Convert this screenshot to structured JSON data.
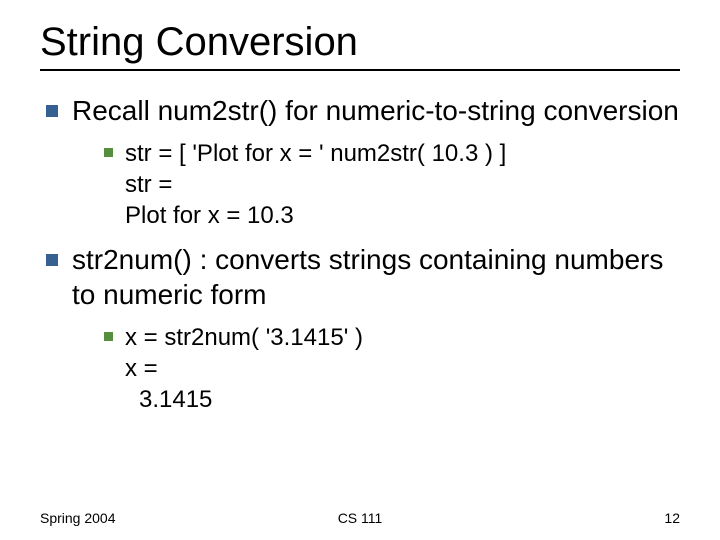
{
  "title": "String Conversion",
  "bullets": [
    {
      "text": "Recall num2str() for numeric-to-string conversion",
      "sub": [
        {
          "line1": "str = [ 'Plot for x = ' num2str( 10.3 ) ]",
          "line2": "str =",
          "line3": "Plot for x = 10.3"
        }
      ]
    },
    {
      "text": "str2num() : converts strings containing numbers to numeric form",
      "sub": [
        {
          "line1": "x = str2num( '3.1415' )",
          "line2": "x =",
          "line3": "3.1415"
        }
      ]
    }
  ],
  "footer": {
    "left": "Spring 2004",
    "center": "CS 111",
    "right": "12"
  }
}
